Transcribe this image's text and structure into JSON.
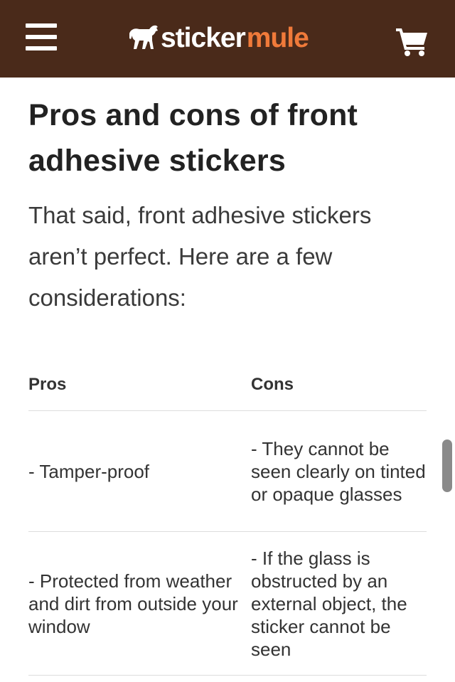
{
  "header": {
    "logo_part1": "sticker",
    "logo_part2": "mule",
    "background_color": "#4a2a1a",
    "accent_color": "#f07a3a",
    "menu_icon": "hamburger-menu-icon",
    "logo_icon": "horse-icon",
    "cart_icon": "shopping-cart-icon"
  },
  "article": {
    "heading": "Pros and cons of front adhesive stickers",
    "intro": "That said, front adhesive stickers aren’t perfect. Here are a few considerations:"
  },
  "table": {
    "headers": [
      "Pros",
      "Cons"
    ],
    "rows": [
      {
        "pro": "- Tamper-proof",
        "con": "- They cannot be seen clearly on tinted or opaque glasses"
      },
      {
        "pro": "- Protected from weather and dirt from outside your window",
        "con": "- If the glass is obstructed by an external object, the sticker cannot be seen"
      }
    ]
  }
}
